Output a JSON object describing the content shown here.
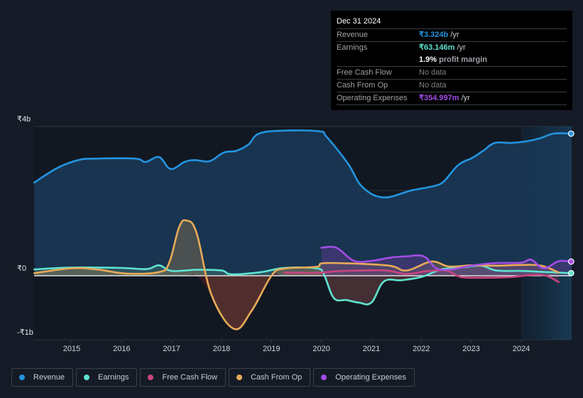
{
  "tooltip": {
    "date": "Dec 31 2024",
    "rows": [
      {
        "label": "Revenue",
        "value": "₹3.324b",
        "unit": " /yr",
        "color": "#2394df"
      },
      {
        "label": "Earnings",
        "value": "₹63.146m",
        "unit": " /yr",
        "color": "#5ee3d0"
      },
      {
        "label": "",
        "value": "1.9%",
        "unit": " profit margin",
        "color": "#ffffff"
      },
      {
        "label": "Free Cash Flow",
        "value": "No data",
        "unit": "",
        "color": "#7d8187"
      },
      {
        "label": "Cash From Op",
        "value": "No data",
        "unit": "",
        "color": "#7d8187"
      },
      {
        "label": "Operating Expenses",
        "value": "₹354.997m",
        "unit": " /yr",
        "color": "#a44de6"
      }
    ]
  },
  "legend": [
    {
      "label": "Revenue",
      "color": "#2394df"
    },
    {
      "label": "Earnings",
      "color": "#5ee3d0"
    },
    {
      "label": "Free Cash Flow",
      "color": "#c9457f"
    },
    {
      "label": "Cash From Op",
      "color": "#e8aa58"
    },
    {
      "label": "Operating Expenses",
      "color": "#a44de6"
    }
  ],
  "chart_data": {
    "type": "area",
    "title": "",
    "xlabel": "",
    "ylabel": "",
    "ylim": [
      -1,
      4
    ],
    "yticks": [
      {
        "value": 4,
        "label": "₹4b"
      },
      {
        "value": 0,
        "label": "₹0"
      },
      {
        "value": -1,
        "label": "-₹1b"
      }
    ],
    "xlim": [
      2014.25,
      2025.0
    ],
    "xticks": [
      2015,
      2016,
      2017,
      2018,
      2019,
      2020,
      2021,
      2022,
      2023,
      2024
    ],
    "forecast_shade_from": 2024.0,
    "grid": true,
    "legend_position": "bottom-left",
    "units": "INR billions",
    "series": [
      {
        "name": "Revenue",
        "color": "#2394df",
        "points": [
          [
            2014.25,
            2.5
          ],
          [
            2014.7,
            2.88
          ],
          [
            2015.13,
            3.1
          ],
          [
            2015.5,
            3.14
          ],
          [
            2016.27,
            3.14
          ],
          [
            2016.48,
            3.05
          ],
          [
            2016.75,
            3.18
          ],
          [
            2016.98,
            2.86
          ],
          [
            2017.26,
            3.05
          ],
          [
            2017.47,
            3.1
          ],
          [
            2017.76,
            3.07
          ],
          [
            2018.04,
            3.3
          ],
          [
            2018.3,
            3.35
          ],
          [
            2018.54,
            3.52
          ],
          [
            2018.75,
            3.81
          ],
          [
            2019.25,
            3.89
          ],
          [
            2019.96,
            3.87
          ],
          [
            2020.1,
            3.73
          ],
          [
            2020.53,
            3.01
          ],
          [
            2020.82,
            2.38
          ],
          [
            2021.24,
            2.1
          ],
          [
            2021.81,
            2.29
          ],
          [
            2022.24,
            2.4
          ],
          [
            2022.45,
            2.53
          ],
          [
            2022.74,
            2.97
          ],
          [
            2023.02,
            3.16
          ],
          [
            2023.24,
            3.35
          ],
          [
            2023.47,
            3.56
          ],
          [
            2023.8,
            3.56
          ],
          [
            2024.09,
            3.6
          ],
          [
            2024.37,
            3.68
          ],
          [
            2024.65,
            3.81
          ],
          [
            2025.0,
            3.81
          ]
        ]
      },
      {
        "name": "Earnings",
        "color": "#5ee3d0",
        "points": [
          [
            2014.25,
            0.17
          ],
          [
            2015.0,
            0.22
          ],
          [
            2016.0,
            0.21
          ],
          [
            2016.5,
            0.18
          ],
          [
            2016.75,
            0.28
          ],
          [
            2017.0,
            0.13
          ],
          [
            2017.5,
            0.16
          ],
          [
            2018.0,
            0.14
          ],
          [
            2018.2,
            0.04
          ],
          [
            2018.8,
            0.1
          ],
          [
            2019.25,
            0.21
          ],
          [
            2019.9,
            0.2
          ],
          [
            2020.05,
            0.03
          ],
          [
            2020.25,
            -0.35
          ],
          [
            2020.5,
            -0.38
          ],
          [
            2020.75,
            -0.42
          ],
          [
            2021.0,
            -0.42
          ],
          [
            2021.25,
            -0.09
          ],
          [
            2021.6,
            -0.07
          ],
          [
            2022.0,
            -0.02
          ],
          [
            2022.4,
            0.17
          ],
          [
            2022.8,
            0.22
          ],
          [
            2023.2,
            0.27
          ],
          [
            2023.5,
            0.14
          ],
          [
            2024.0,
            0.13
          ],
          [
            2024.5,
            0.1
          ],
          [
            2025.0,
            0.07
          ]
        ]
      },
      {
        "name": "Free Cash Flow",
        "color": "#c9457f",
        "points": [
          [
            2019.25,
            0.09
          ],
          [
            2019.9,
            0.08
          ],
          [
            2020.3,
            0.12
          ],
          [
            2020.8,
            0.14
          ],
          [
            2021.3,
            0.14
          ],
          [
            2021.7,
            0.05
          ],
          [
            2022.1,
            0.12
          ],
          [
            2022.5,
            0.14
          ],
          [
            2022.8,
            -0.02
          ],
          [
            2023.3,
            -0.03
          ],
          [
            2023.8,
            -0.02
          ],
          [
            2024.2,
            0.02
          ],
          [
            2024.5,
            0.0
          ],
          [
            2024.75,
            -0.1
          ]
        ]
      },
      {
        "name": "Cash From Op",
        "color": "#e8aa58",
        "points": [
          [
            2014.25,
            0.07
          ],
          [
            2015.0,
            0.2
          ],
          [
            2015.5,
            0.17
          ],
          [
            2016.1,
            0.06
          ],
          [
            2016.75,
            0.1
          ],
          [
            2016.95,
            0.34
          ],
          [
            2017.15,
            1.3
          ],
          [
            2017.3,
            1.48
          ],
          [
            2017.5,
            1.15
          ],
          [
            2017.8,
            -0.3
          ],
          [
            2018.25,
            -0.83
          ],
          [
            2018.6,
            -0.55
          ],
          [
            2019.0,
            0.0
          ],
          [
            2019.25,
            0.19
          ],
          [
            2019.9,
            0.24
          ],
          [
            2020.1,
            0.34
          ],
          [
            2021.3,
            0.28
          ],
          [
            2021.7,
            0.14
          ],
          [
            2022.2,
            0.38
          ],
          [
            2022.55,
            0.25
          ],
          [
            2023.0,
            0.28
          ],
          [
            2023.5,
            0.27
          ],
          [
            2024.0,
            0.29
          ],
          [
            2024.4,
            0.27
          ],
          [
            2024.75,
            0.09
          ]
        ]
      },
      {
        "name": "Operating Expenses",
        "color": "#a44de6",
        "points": [
          [
            2020.0,
            0.75
          ],
          [
            2020.3,
            0.75
          ],
          [
            2020.65,
            0.4
          ],
          [
            2021.0,
            0.4
          ],
          [
            2021.4,
            0.49
          ],
          [
            2021.7,
            0.52
          ],
          [
            2022.05,
            0.52
          ],
          [
            2022.3,
            0.2
          ],
          [
            2022.6,
            0.17
          ],
          [
            2023.0,
            0.27
          ],
          [
            2023.5,
            0.34
          ],
          [
            2024.0,
            0.35
          ],
          [
            2024.2,
            0.43
          ],
          [
            2024.45,
            0.2
          ],
          [
            2024.75,
            0.39
          ],
          [
            2025.0,
            0.38
          ]
        ]
      }
    ]
  }
}
